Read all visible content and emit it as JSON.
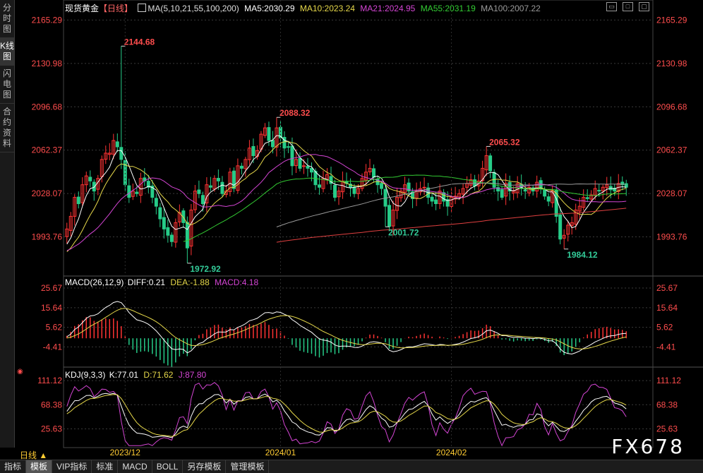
{
  "header": {
    "symbol": "现货黄金",
    "period_tag": "【日线】",
    "ma_icon": "grid-icon",
    "ma_params": "MA(5,10,21,55,100,200)",
    "ma_values": [
      {
        "label": "MA5:2030.29",
        "color": "#ffffff"
      },
      {
        "label": "MA10:2023.24",
        "color": "#e6d84a"
      },
      {
        "label": "MA21:2024.95",
        "color": "#d445d4"
      },
      {
        "label": "MA55:2031.19",
        "color": "#33cc33"
      },
      {
        "label": "MA100:2007.22",
        "color": "#9a9a9a"
      }
    ]
  },
  "sidebar": {
    "tabs": [
      {
        "label": "分时图",
        "active": false
      },
      {
        "label": "K线图",
        "active": true
      },
      {
        "label": "闪电图",
        "active": false
      },
      {
        "label": "合约资料",
        "active": false
      }
    ]
  },
  "price_axis": {
    "ticks": [
      2165.29,
      2130.98,
      2096.68,
      2062.37,
      2028.07,
      1993.76
    ],
    "color": "#ff4d4d"
  },
  "annotations": [
    {
      "text": "2144.68",
      "price": 2144.68,
      "index": 14,
      "color": "#ff4d4d"
    },
    {
      "text": "2088.32",
      "price": 2088.32,
      "index": 54,
      "color": "#ff4d4d"
    },
    {
      "text": "2065.32",
      "price": 2065.32,
      "index": 108,
      "color": "#ff4d4d"
    },
    {
      "text": "1972.92",
      "price": 1972.92,
      "index": 31,
      "color": "#33cc99"
    },
    {
      "text": "2001.72",
      "price": 2001.72,
      "index": 82,
      "color": "#33cc99"
    },
    {
      "text": "1984.12",
      "price": 1984.12,
      "index": 128,
      "color": "#33cc99"
    }
  ],
  "macd": {
    "label": "MACD(26,12,9)",
    "diff": "DIFF:0.21",
    "dea": "DEA:-1.88",
    "macd": "MACD:4.18",
    "ticks": [
      25.67,
      15.64,
      5.62,
      -4.41
    ],
    "diff_color": "#ffffff",
    "dea_color": "#e6d84a",
    "macd_color": "#d445d4"
  },
  "kdj": {
    "label": "KDJ(9,3,3)",
    "k": "K:77.01",
    "d": "D:71.62",
    "j": "J:87.80",
    "ticks": [
      111.12,
      68.38,
      25.63
    ],
    "k_color": "#ffffff",
    "d_color": "#e6d84a",
    "j_color": "#d445d4"
  },
  "date_axis": {
    "labels": [
      {
        "text": "2023/12",
        "index": 15
      },
      {
        "text": "2024/01",
        "index": 55
      },
      {
        "text": "2024/02",
        "index": 99
      }
    ]
  },
  "period_bar": {
    "label": "日线 ▲"
  },
  "bottom_tabs": [
    {
      "label": "指标",
      "active": false
    },
    {
      "label": "模板",
      "active": true
    },
    {
      "label": "VIP指标",
      "active": false
    },
    {
      "label": "标准",
      "active": false
    },
    {
      "label": "MACD",
      "active": false
    },
    {
      "label": "BOLL",
      "active": false
    },
    {
      "label": "另存模板",
      "active": false
    },
    {
      "label": "管理模板",
      "active": false
    }
  ],
  "watermark": "FX678",
  "colors": {
    "up": "#ff3333",
    "down": "#26cc88",
    "grid": "#3a3a3a"
  },
  "chart_data": {
    "type": "candlestick",
    "x_range": [
      "2023-11",
      "2024-03"
    ],
    "ylim": [
      1965,
      2170
    ],
    "candles_close": [
      2000,
      2010,
      2025,
      2020,
      2035,
      2042,
      2038,
      2030,
      2040,
      2055,
      2060,
      2060,
      2070,
      2065,
      2055,
      2035,
      2025,
      2030,
      2028,
      2040,
      2038,
      2033,
      2025,
      2018,
      2008,
      2000,
      1995,
      1990,
      2005,
      2013,
      2005,
      1985,
      2015,
      2030,
      2028,
      2020,
      2035,
      2033,
      2040,
      2038,
      2028,
      2030,
      2045,
      2032,
      2050,
      2048,
      2055,
      2064,
      2058,
      2062,
      2075,
      2080,
      2070,
      2065,
      2080,
      2072,
      2064,
      2065,
      2050,
      2055,
      2048,
      2050,
      2048,
      2045,
      2035,
      2033,
      2040,
      2043,
      2036,
      2025,
      2030,
      2038,
      2036,
      2033,
      2028,
      2032,
      2040,
      2045,
      2048,
      2041,
      2035,
      2032,
      2018,
      2002,
      2015,
      2025,
      2030,
      2035,
      2030,
      2024,
      2030,
      2032,
      2033,
      2025,
      2022,
      2020,
      2030,
      2022,
      2018,
      2025,
      2026,
      2028,
      2032,
      2036,
      2039,
      2034,
      2038,
      2048,
      2058,
      2046,
      2033,
      2030,
      2025,
      2036,
      2030,
      2030,
      2036,
      2032,
      2030,
      2033,
      2030,
      2037,
      2032,
      2026,
      2022,
      2030,
      2010,
      1992,
      1995,
      2003,
      2005,
      2015,
      2018,
      2025,
      2024,
      2027,
      2032,
      2030,
      2033,
      2035,
      2031,
      2030,
      2036,
      2035,
      2033
    ]
  }
}
